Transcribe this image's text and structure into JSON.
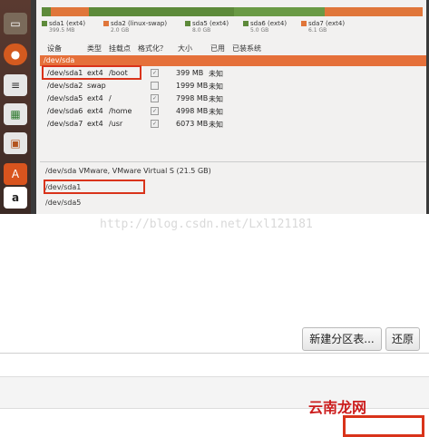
{
  "disk_legend": [
    {
      "name": "sda1 (ext4)",
      "size": "399.5 MB",
      "color": "#5d8a3a"
    },
    {
      "name": "sda2 (linux-swap)",
      "size": "2.0 GB",
      "color": "#e0763a"
    },
    {
      "name": "sda5 (ext4)",
      "size": "8.0 GB",
      "color": "#5d8a3a"
    },
    {
      "name": "sda6 (ext4)",
      "size": "5.0 GB",
      "color": "#5d8a3a"
    },
    {
      "name": "sda7 (ext4)",
      "size": "6.1 GB",
      "color": "#e0763a"
    }
  ],
  "table": {
    "columns": [
      "设备",
      "类型",
      "挂载点",
      "格式化？",
      "大小",
      "已用",
      "已装系统"
    ],
    "disk_row": "/dev/sda",
    "rows": [
      {
        "device": "/dev/sda1",
        "type": "ext4",
        "mount": "/boot",
        "format": "✓",
        "size": "399 MB",
        "used": "未知"
      },
      {
        "device": "/dev/sda2",
        "type": "swap",
        "mount": "",
        "format": "",
        "size": "1999 MB",
        "used": "未知"
      },
      {
        "device": "/dev/sda5",
        "type": "ext4",
        "mount": "/",
        "format": "✓",
        "size": "7998 MB",
        "used": "未知"
      },
      {
        "device": "/dev/sda6",
        "type": "ext4",
        "mount": "/home",
        "format": "✓",
        "size": "4998 MB",
        "used": "未知"
      },
      {
        "device": "/dev/sda7",
        "type": "ext4",
        "mount": "/usr",
        "format": "✓",
        "size": "6073 MB",
        "used": "未知"
      }
    ]
  },
  "devices": {
    "line1": "/dev/sda   VMware, VMware Virtual S (21.5 GB)",
    "line2": "/dev/sda1",
    "line3": "/dev/sda5"
  },
  "watermark": "http://blog.csdn.net/Lxl121181",
  "buttons": {
    "new_partition_table": "新建分区表...",
    "revert": "还原"
  },
  "logo": "云南龙网",
  "launcher_icons": [
    "files-icon",
    "firefox-icon",
    "writer-icon",
    "calc-icon",
    "impress-icon",
    "software-center-icon",
    "amazon-icon",
    "settings-icon"
  ]
}
